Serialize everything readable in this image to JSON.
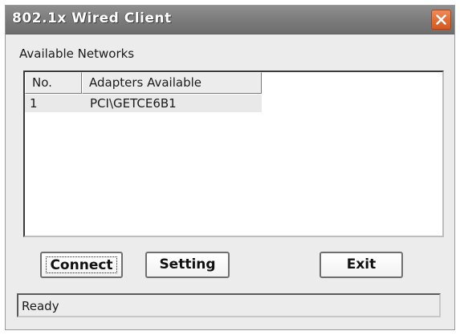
{
  "window": {
    "title": "802.1x Wired Client"
  },
  "networks": {
    "section_label": "Available Networks",
    "columns": [
      "No.",
      "Adapters Available"
    ],
    "rows": [
      {
        "no": "1",
        "adapter": "PCI\\GETCE6B1"
      }
    ]
  },
  "buttons": {
    "connect": "Connect",
    "setting": "Setting",
    "exit": "Exit"
  },
  "status": {
    "text": "Ready"
  },
  "icons": {
    "close": "close-icon"
  },
  "colors": {
    "titlebar": "#7a7a7a",
    "close_button": "#e06a30",
    "window_bg": "#ececec"
  }
}
